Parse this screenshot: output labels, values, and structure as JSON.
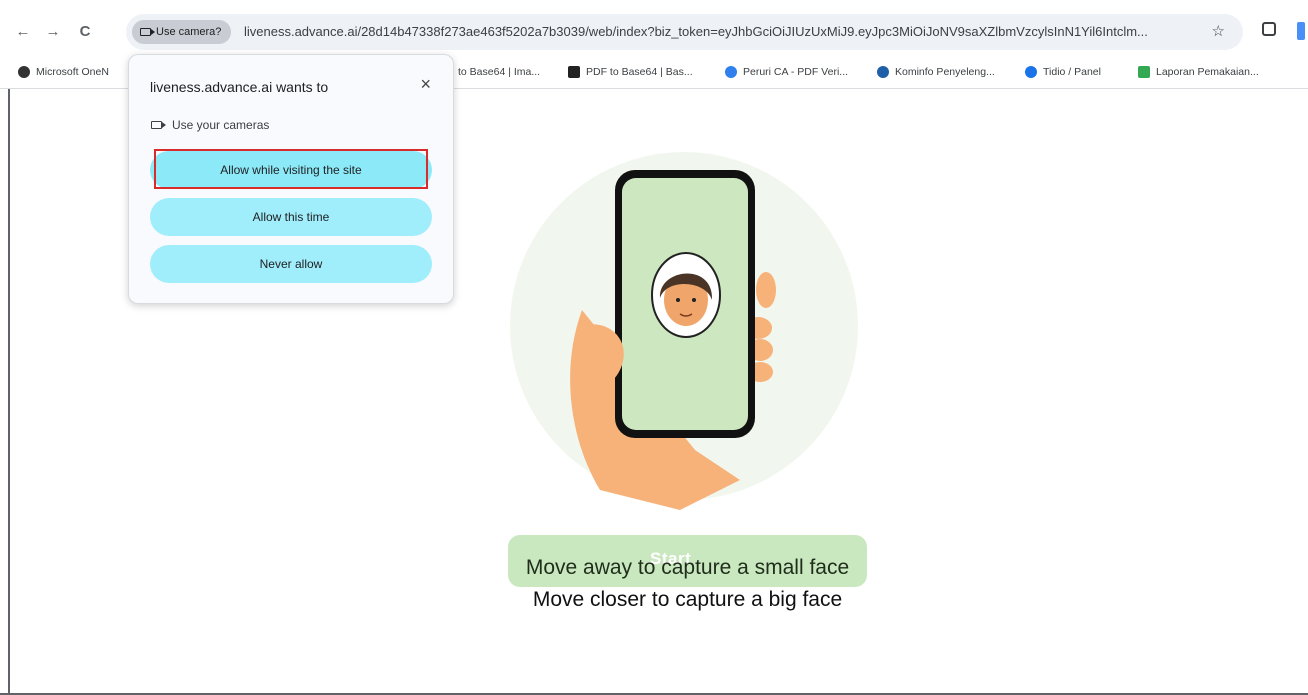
{
  "browser": {
    "camera_chip_label": "Use camera?",
    "url": "liveness.advance.ai/28d14b47338f273ae463f5202a7b3039/web/index?biz_token=eyJhbGciOiJIUzUxMiJ9.eyJpc3MiOiJoNV9saXZlbmVzcylsInN1Yil6Intclm...",
    "star_glyph": "☆",
    "back_glyph": "←",
    "forward_glyph": "→",
    "reload_glyph": "C"
  },
  "bookmarks": [
    {
      "label": "Microsoft OneN",
      "color": "#333333"
    },
    {
      "label": "to Base64 | Ima...",
      "color": "#ffffff"
    },
    {
      "label": "PDF to Base64 | Bas...",
      "color": "#222222"
    },
    {
      "label": "Peruri CA - PDF Veri...",
      "color": "#2f80ed"
    },
    {
      "label": "Kominfo Penyeleng...",
      "color": "#1f5fa8"
    },
    {
      "label": "Tidio / Panel",
      "color": "#1a73e8"
    },
    {
      "label": "Laporan Pemakaian...",
      "color": "#34a853"
    }
  ],
  "permission": {
    "title": "liveness.advance.ai wants to",
    "close_glyph": "×",
    "request": "Use your cameras",
    "buttons": [
      {
        "label": "Allow while visiting the site"
      },
      {
        "label": "Allow this time"
      },
      {
        "label": "Never allow"
      }
    ]
  },
  "page": {
    "start_label": "Start",
    "instruction_1": "Move away to capture a small face",
    "instruction_2": "Move closer to capture a big face"
  },
  "colors": {
    "accent_button": "#a0eefb",
    "highlight": "#d92b2b",
    "phone_screen": "#cde8c0",
    "skin": "#f7b27a"
  }
}
